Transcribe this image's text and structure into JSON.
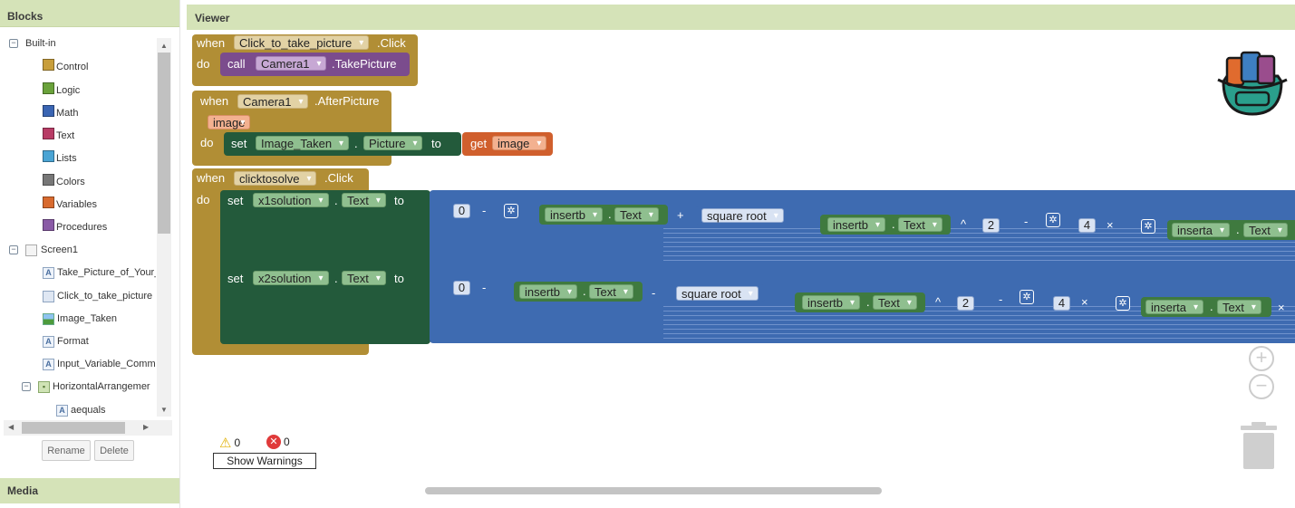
{
  "blocks_panel": {
    "title": "Blocks",
    "builtin_label": "Built-in",
    "builtin": [
      {
        "label": "Control",
        "color": "#c89e3b"
      },
      {
        "label": "Logic",
        "color": "#6aa23b"
      },
      {
        "label": "Math",
        "color": "#3a65b3"
      },
      {
        "label": "Text",
        "color": "#b83c66"
      },
      {
        "label": "Lists",
        "color": "#4aa4d4"
      },
      {
        "label": "Colors",
        "color": "#777777"
      },
      {
        "label": "Variables",
        "color": "#d86a2e"
      },
      {
        "label": "Procedures",
        "color": "#8a5aa6"
      }
    ],
    "screen_label": "Screen1",
    "components": [
      "Take_Picture_of_Your_",
      "Click_to_take_picture",
      "Image_Taken",
      "Format",
      "Input_Variable_Comm",
      "HorizontalArrangemer",
      "aequals"
    ],
    "rename_label": "Rename",
    "delete_label": "Delete"
  },
  "media_panel": {
    "title": "Media"
  },
  "viewer": {
    "title": "Viewer",
    "block1": {
      "when": "when",
      "component": "Click_to_take_picture",
      "event": ".Click",
      "do": "do",
      "call": "call",
      "call_component": "Camera1",
      "method": ".TakePicture"
    },
    "block2": {
      "when": "when",
      "component": "Camera1",
      "event": ".AfterPicture",
      "param": "image",
      "do": "do",
      "set": "set",
      "target": "Image_Taken",
      "dot": ".",
      "property": "Picture",
      "to": "to",
      "get": "get",
      "get_var": "image"
    },
    "block3": {
      "when": "when",
      "component": "clicktosolve",
      "event": ".Click",
      "do": "do",
      "row1": {
        "set": "set",
        "target": "x1solution",
        "dot": ".",
        "property": "Text",
        "to": "to",
        "zero": "0",
        "minus": "-",
        "b": "insertb",
        "b_prop": "Text",
        "op": "+",
        "sqrt": "square root",
        "caret": "^",
        "two": "2",
        "minus2": "-",
        "four": "4",
        "times": "×",
        "a": "inserta",
        "a_prop": "Text"
      },
      "row2": {
        "set": "set",
        "target": "x2solution",
        "dot": ".",
        "property": "Text",
        "to": "to",
        "zero": "0",
        "minus": "-",
        "b": "insertb",
        "b_prop": "Text",
        "op": "-",
        "sqrt": "square root",
        "caret": "^",
        "two": "2",
        "minus2": "-",
        "four": "4",
        "times": "×",
        "a": "inserta",
        "a_prop": "Text",
        "times2": "×"
      }
    },
    "warnings": {
      "warning_count": "0",
      "error_count": "0",
      "button": "Show Warnings"
    }
  }
}
